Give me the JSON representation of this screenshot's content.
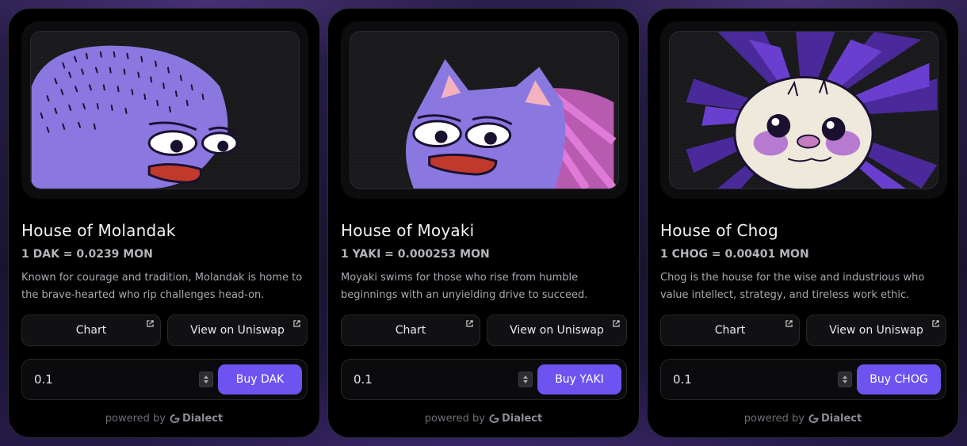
{
  "footer": {
    "powered_by": "powered by",
    "brand": "Dialect"
  },
  "cards": [
    {
      "title": "House of Molandak",
      "rate": "1 DAK = 0.0239 MON",
      "description": "Known for courage and tradition, Molandak is home to the brave-hearted who rip challenges head-on.",
      "chart_label": "Chart",
      "uniswap_label": "View on Uniswap",
      "amount": "0.1",
      "buy_label": "Buy DAK"
    },
    {
      "title": "House of Moyaki",
      "rate": "1 YAKI = 0.000253 MON",
      "description": "Moyaki swims for those who rise from humble beginnings with an unyielding drive to succeed.",
      "chart_label": "Chart",
      "uniswap_label": "View on Uniswap",
      "amount": "0.1",
      "buy_label": "Buy YAKI"
    },
    {
      "title": "House of Chog",
      "rate": "1 CHOG = 0.00401 MON",
      "description": "Chog is the house for the wise and industrious who value intellect, strategy, and tireless work ethic.",
      "chart_label": "Chart",
      "uniswap_label": "View on Uniswap",
      "amount": "0.1",
      "buy_label": "Buy CHOG"
    }
  ],
  "colors": {
    "accent": "#6e53f0",
    "card_bg": "#000000",
    "text_muted": "#a9a9b1"
  }
}
